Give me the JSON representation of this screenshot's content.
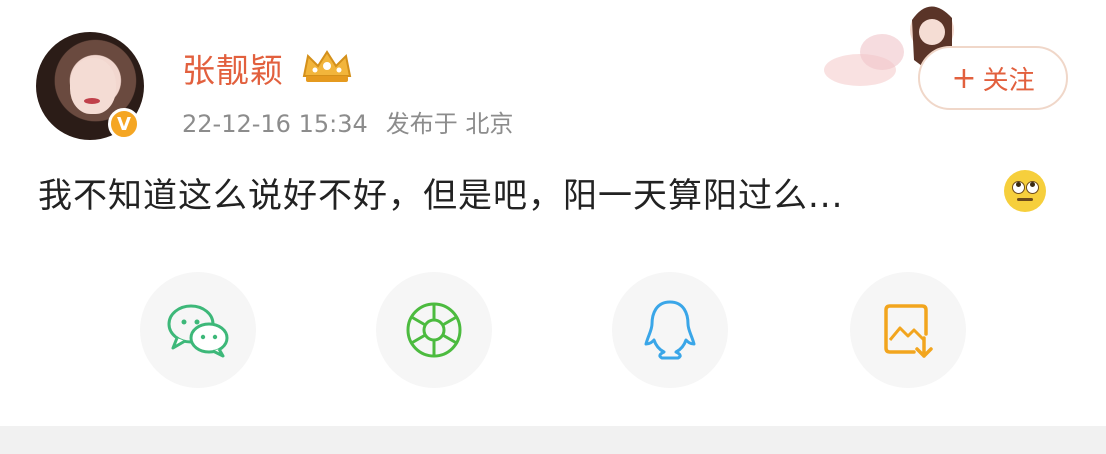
{
  "user": {
    "name": "张靓颖",
    "verified_badge": "V",
    "crown_icon": "crown-icon"
  },
  "post": {
    "timestamp": "22-12-16 15:34",
    "location": "发布于 北京",
    "text": "我不知道这么说好不好，但是吧，阳一天算阳过么..."
  },
  "follow_button": {
    "plus": "+",
    "label": "关注"
  },
  "share": {
    "items": [
      {
        "icon": "wechat-icon"
      },
      {
        "icon": "moments-icon"
      },
      {
        "icon": "qq-icon"
      },
      {
        "icon": "save-image-icon"
      }
    ]
  },
  "colors": {
    "accent": "#e2603e",
    "verified": "#f5a623",
    "wechat": "#3db879",
    "moments": "#4cbb3f",
    "qq": "#3aa6e8",
    "save": "#f2a51e"
  }
}
